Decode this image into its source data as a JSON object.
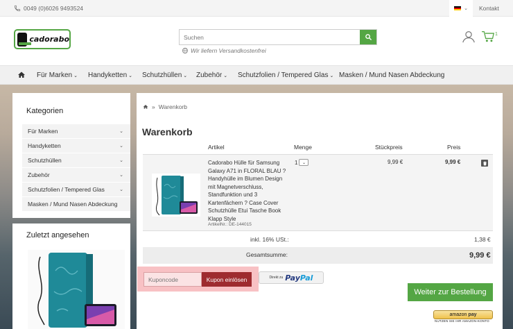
{
  "topbar": {
    "phone": "0049 (0)6026 9493524",
    "lang_flag_colors": [
      "#000000",
      "#dd0000",
      "#ffce00"
    ],
    "contact": "Kontakt"
  },
  "header": {
    "logo_text": "cadorabo",
    "search_placeholder": "Suchen",
    "shipping_note": "Wir liefern Versandkostenfrei",
    "cart_count": "1"
  },
  "nav": {
    "items": [
      {
        "label": "Für Marken",
        "has_dropdown": true
      },
      {
        "label": "Handyketten",
        "has_dropdown": true
      },
      {
        "label": "Schutzhüllen",
        "has_dropdown": true
      },
      {
        "label": "Zubehör",
        "has_dropdown": true
      },
      {
        "label": "Schutzfolien / Tempered Glas",
        "has_dropdown": true
      },
      {
        "label": "Masken / Mund Nasen Abdeckung",
        "has_dropdown": false
      }
    ]
  },
  "sidebar": {
    "categories_title": "Kategorien",
    "categories": [
      "Für Marken",
      "Handyketten",
      "Schutzhüllen",
      "Zubehör",
      "Schutzfolien / Tempered Glas",
      "Masken / Mund Nasen Abdeckung"
    ],
    "recent_title": "Zuletzt angesehen"
  },
  "breadcrumb": {
    "current": "Warenkorb"
  },
  "cart": {
    "title": "Warenkorb",
    "headers": {
      "article": "Artikel",
      "quantity": "Menge",
      "unit_price": "Stückpreis",
      "price": "Preis"
    },
    "item": {
      "description": "Cadorabo Hülle für Samsung Galaxy A71 in FLORAL BLAU ? Handyhülle im Blumen Design mit Magnetverschluss, Standfunktion und 3 Kartenfächern ? Case Cover Schutzhülle Etui Tasche Book Klapp Style",
      "article_number": "ArtikelNr.: DE-144015",
      "quantity": "1",
      "unit_price": "9,99 €",
      "price": "9,99 €"
    },
    "tax_label": "inkl. 16% USt.:",
    "tax_value": "1,38 €",
    "total_label": "Gesamtsumme:",
    "total_value": "9,99 €"
  },
  "actions": {
    "coupon_placeholder": "Kuponcode",
    "coupon_button": "Kupon einlösen",
    "paypal_prefix": "Direkt zu",
    "paypal_logo_1": "Pay",
    "paypal_logo_2": "Pal",
    "checkout_button": "Weiter zur Bestellung",
    "amazon_brand": "amazon",
    "amazon_pay": "pay",
    "amazon_note": "NUTZEN SIE IHR AMAZON-KONTO"
  },
  "colors": {
    "brand_green": "#54a644",
    "coupon_red": "#9e2b2f",
    "coupon_highlight": "#f8c1c4"
  }
}
